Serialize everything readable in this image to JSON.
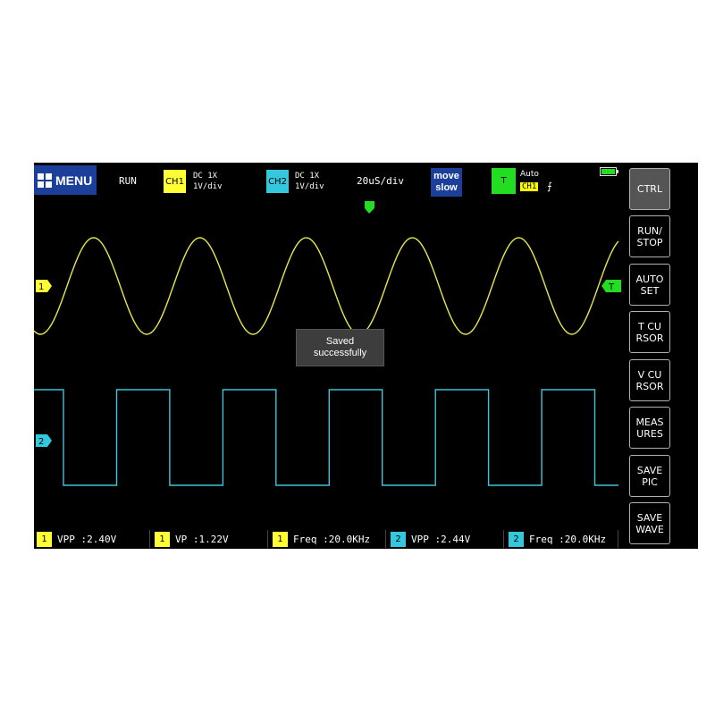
{
  "top_bar": {
    "menu_label": "MENU",
    "run_status": "RUN",
    "ch1": {
      "badge": "CH1",
      "coupling": "DC  1X",
      "scale": "1V/div"
    },
    "ch2": {
      "badge": "CH2",
      "coupling": "DC  1X",
      "scale": "1V/div"
    },
    "timebase": "20uS/div",
    "move_line1": "move",
    "move_line2": "slow",
    "trigger": {
      "badge": "T",
      "mode": "Auto",
      "source": "CH1",
      "edge_symbol": "⨍"
    }
  },
  "markers": {
    "ch1": "1",
    "ch2": "2",
    "trigger_level": "T"
  },
  "toast": {
    "line1": "Saved",
    "line2": "successfully"
  },
  "side_buttons": [
    {
      "id": "ctrl",
      "label": "CTRL"
    },
    {
      "id": "run-stop",
      "label": "RUN/\nSTOP"
    },
    {
      "id": "auto-set",
      "label": "AUTO\nSET"
    },
    {
      "id": "t-cursor",
      "label": "T CU\nRSOR"
    },
    {
      "id": "v-cursor",
      "label": "V CU\nRSOR"
    },
    {
      "id": "measures",
      "label": "MEAS\nURES"
    },
    {
      "id": "save-pic",
      "label": "SAVE\nPIC"
    },
    {
      "id": "save-wave",
      "label": "SAVE\nWAVE"
    }
  ],
  "measurements": [
    {
      "ch": "1",
      "label": "VPP :",
      "value": "2.40V"
    },
    {
      "ch": "1",
      "label": "VP  :",
      "value": "1.22V"
    },
    {
      "ch": "1",
      "label": "Freq :",
      "value": "20.0KHz"
    },
    {
      "ch": "2",
      "label": "VPP :",
      "value": "2.44V"
    },
    {
      "ch": "2",
      "label": "Freq :",
      "value": "20.0KHz"
    }
  ],
  "colors": {
    "ch1": "#ffff33",
    "ch2": "#33c8dd",
    "trigger": "#22dd22",
    "menu": "#1c3f9b",
    "ch1_trace": "#e8e84a",
    "ch2_trace": "#3fc3d6"
  },
  "waveforms": {
    "ch1": {
      "shape": "sine",
      "cycles_on_screen": 5.5
    },
    "ch2": {
      "shape": "square",
      "cycles_on_screen": 5.5
    }
  }
}
